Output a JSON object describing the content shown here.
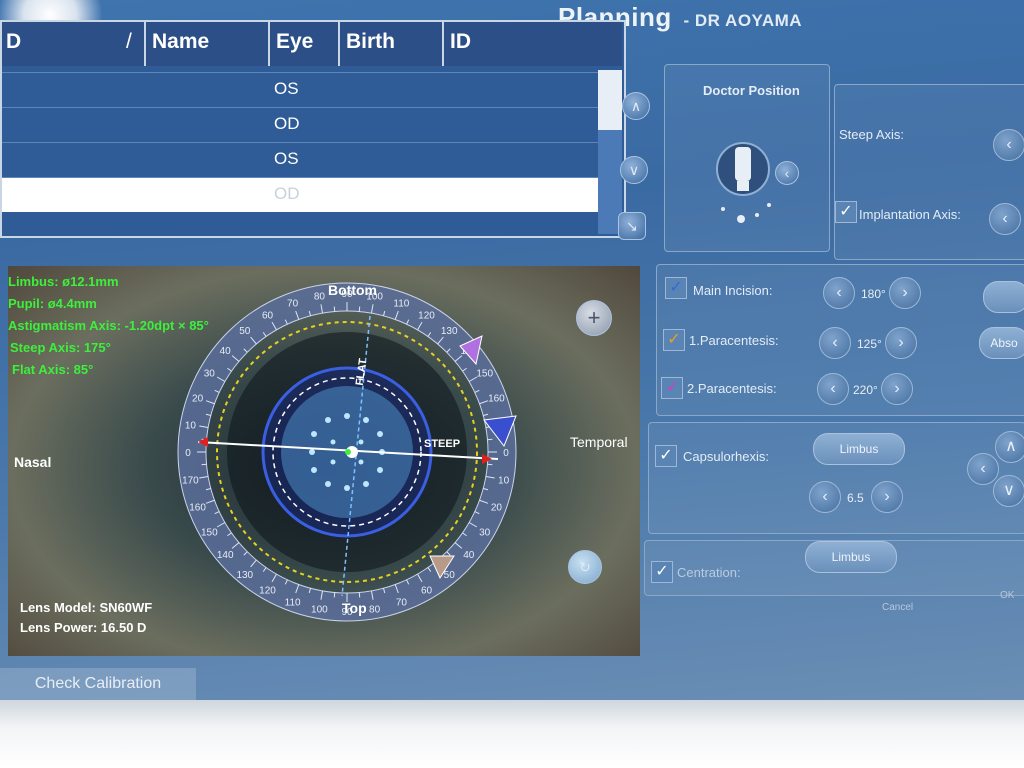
{
  "header": {
    "title": "Planning",
    "subtitle": "- DR AOYAMA"
  },
  "table": {
    "columns": [
      "D",
      "/",
      "Name",
      "Eye",
      "Birth",
      "ID"
    ],
    "rows": [
      {
        "eye": "OS"
      },
      {
        "eye": "OD"
      },
      {
        "eye": "OS"
      },
      {
        "eye": "OD"
      }
    ]
  },
  "doctor_position": {
    "title": "Doctor Position"
  },
  "axes": {
    "steep_axis_label": "Steep Axis:",
    "implantation_axis_label": "Implantation Axis:"
  },
  "incisions": {
    "main": {
      "label": "Main Incision:",
      "value": "180°",
      "check_color": "#2e6bd8"
    },
    "para1": {
      "label": "1.Paracentesis:",
      "value": "125°",
      "check_color": "#e8a020"
    },
    "para2": {
      "label": "2.Paracentesis:",
      "value": "220°",
      "check_color": "#d040c0"
    },
    "side_button_label": "Abso"
  },
  "capsulorhexis": {
    "label": "Capsulorhexis:",
    "mode": "Limbus",
    "value": "6.5"
  },
  "centration": {
    "label": "Centration:",
    "mode": "Limbus"
  },
  "footer": {
    "cancel": "Cancel",
    "ok": "OK",
    "check_calibration": "Check Calibration"
  },
  "eye_view": {
    "measurements": {
      "limbus": "Limbus: ø12.1mm",
      "pupil": "Pupil: ø4.4mm",
      "astigmatism": "Astigmatism Axis: -1.20dpt × 85°",
      "steep_axis": "Steep Axis: 175°",
      "flat_axis": "Flat Axis: 85°"
    },
    "labels": {
      "bottom": "Bottom",
      "top": "Top",
      "nasal": "Nasal",
      "temporal": "Temporal",
      "flat": "FLAT",
      "steep": "STEEP"
    },
    "ring_ticks": [
      "0",
      "10",
      "20",
      "30",
      "40",
      "50",
      "60",
      "70",
      "80",
      "90",
      "100",
      "110",
      "120",
      "130",
      "140",
      "150",
      "160",
      "170"
    ],
    "lens_model": "Lens Model: SN60WF",
    "lens_power": "Lens Power: 16.50 D",
    "colors": {
      "measure_text": "#3cf03c",
      "yellow_ring": "#e8d020",
      "blue_ring": "#3a5fe0"
    }
  }
}
